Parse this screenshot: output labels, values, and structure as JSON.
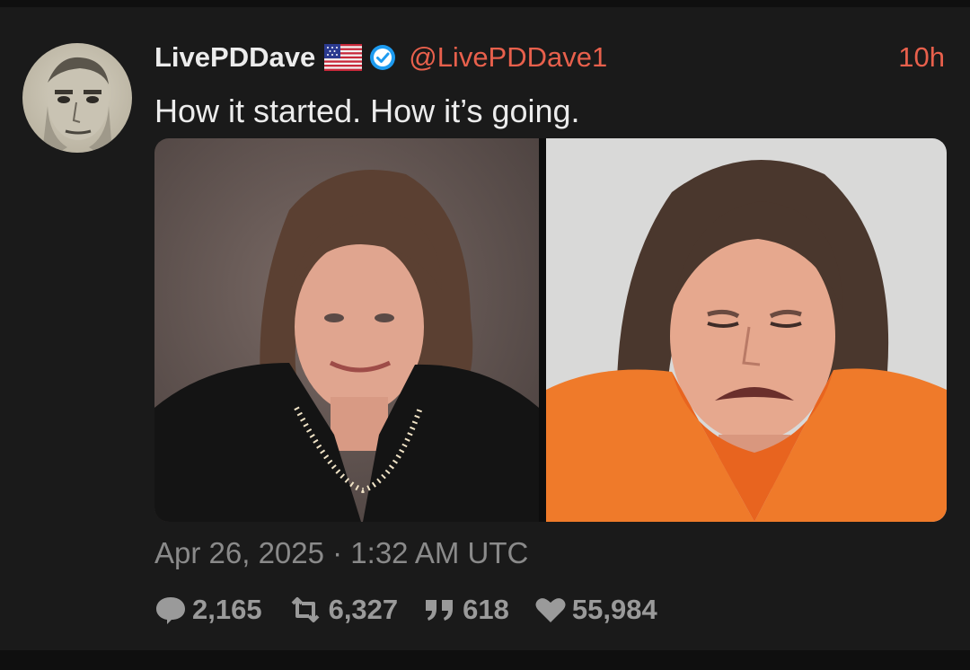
{
  "tweet": {
    "display_name": "LivePDDave",
    "handle": "@LivePDDave1",
    "time_ago": "10h",
    "text": "How it started. How it’s going.",
    "date": "Apr 26, 2025 · 1:32 AM UTC",
    "stats": {
      "replies": "2,165",
      "retweets": "6,327",
      "quotes": "618",
      "likes": "55,984"
    }
  },
  "colors": {
    "background": "#1a1a1a",
    "accent": "#e8604c",
    "primary_text": "#ececec",
    "muted_text": "#8a8a8a",
    "verified": "#1d9bf0"
  },
  "icons": {
    "flag": "us-flag-icon",
    "verified": "verified-badge-icon",
    "reply": "comment-bubble-icon",
    "retweet": "retweet-icon",
    "quote": "quote-icon",
    "like": "heart-icon"
  }
}
